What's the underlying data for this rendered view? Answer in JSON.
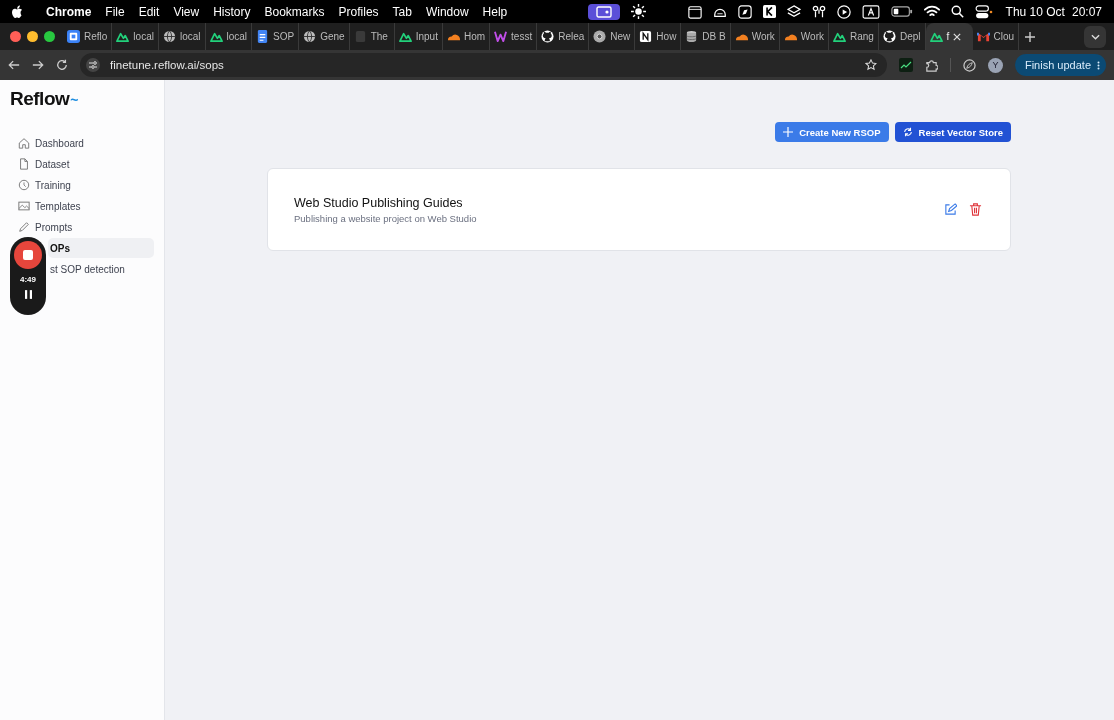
{
  "menubar": {
    "app": "Chrome",
    "menus": [
      "File",
      "Edit",
      "View",
      "History",
      "Bookmarks",
      "Profiles",
      "Tab",
      "Window",
      "Help"
    ],
    "date": "Thu 10 Oct",
    "time": "20:07"
  },
  "tabs": [
    {
      "title": "Reflo",
      "kind": "reflow",
      "selected": false
    },
    {
      "title": "local",
      "kind": "nuxt",
      "selected": false
    },
    {
      "title": "local",
      "kind": "globe",
      "selected": false
    },
    {
      "title": "local",
      "kind": "nuxt",
      "selected": false
    },
    {
      "title": "SOP",
      "kind": "docs",
      "selected": false
    },
    {
      "title": "Gene",
      "kind": "globe",
      "selected": false
    },
    {
      "title": "The",
      "kind": "dark",
      "selected": false
    },
    {
      "title": "Input",
      "kind": "nuxt",
      "selected": false
    },
    {
      "title": "Hom",
      "kind": "cloud",
      "selected": false
    },
    {
      "title": "tesst",
      "kind": "webstudio",
      "selected": false
    },
    {
      "title": "Relea",
      "kind": "github",
      "selected": false
    },
    {
      "title": "New",
      "kind": "chrome",
      "selected": false
    },
    {
      "title": "How",
      "kind": "notion",
      "selected": false
    },
    {
      "title": "DB B",
      "kind": "db",
      "selected": false
    },
    {
      "title": "Work",
      "kind": "cloud",
      "selected": false
    },
    {
      "title": "Work",
      "kind": "cloud",
      "selected": false
    },
    {
      "title": "Rang",
      "kind": "nuxt",
      "selected": false
    },
    {
      "title": "Depl",
      "kind": "github",
      "selected": false
    },
    {
      "title": "f",
      "kind": "nuxt",
      "selected": true
    },
    {
      "title": "Clou",
      "kind": "gmail",
      "selected": false
    }
  ],
  "address_bar": {
    "url": "finetune.reflow.ai/sops",
    "avatar": "Y",
    "update_button": "Finish update"
  },
  "sidebar": {
    "logo": "Reflow",
    "logo_mark": "~",
    "items": [
      {
        "label": "Dashboard",
        "kind": "home",
        "selected": false
      },
      {
        "label": "Dataset",
        "kind": "file",
        "selected": false
      },
      {
        "label": "Training",
        "kind": "clock",
        "selected": false
      },
      {
        "label": "Templates",
        "kind": "image",
        "selected": false
      },
      {
        "label": "Prompts",
        "kind": "pencil",
        "selected": false
      },
      {
        "label": "OPs",
        "selected": true
      },
      {
        "label": "st SOP detection",
        "selected": false
      }
    ]
  },
  "recorder": {
    "time": "4:49"
  },
  "actions": [
    {
      "label": "Create New RSOP",
      "kind": "create",
      "hovered": false
    },
    {
      "label": "Reset Vector Store",
      "kind": "reset",
      "hovered": true
    }
  ],
  "sops": [
    {
      "title": "Web Studio Publishing Guides",
      "description": "Publishing a website project on Web Studio"
    }
  ]
}
